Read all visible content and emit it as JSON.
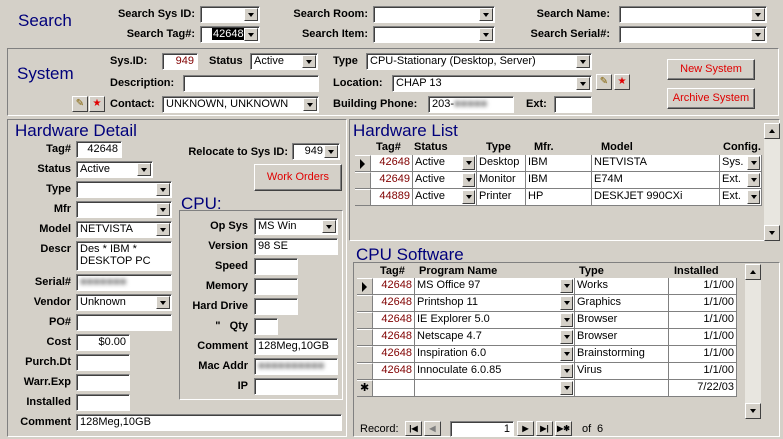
{
  "search": {
    "title": "Search",
    "sys_id_label": "Search Sys ID:",
    "sys_id_value": "",
    "tag_label": "Search Tag#:",
    "tag_value": "42648",
    "room_label": "Search Room:",
    "room_value": "",
    "item_label": "Search Item:",
    "item_value": "",
    "name_label": "Search Name:",
    "name_value": "",
    "serial_label": "Search Serial#:",
    "serial_value": ""
  },
  "system": {
    "title": "System",
    "sys_id_label": "Sys.ID:",
    "sys_id_value": "949",
    "status_label": "Status",
    "status_value": "Active",
    "type_label": "Type",
    "type_value": "CPU-Stationary (Desktop, Server)",
    "description_label": "Description:",
    "description_value": "",
    "location_label": "Location:",
    "location_value": "CHAP 13",
    "contact_label": "Contact:",
    "contact_value": "UNKNOWN, UNKNOWN",
    "building_phone_label": "Building Phone:",
    "building_phone_value": "203-",
    "ext_label": "Ext:",
    "ext_value": "",
    "new_system_button": "New System",
    "archive_system_button": "Archive System"
  },
  "hardware_detail": {
    "title": "Hardware Detail",
    "tag_label": "Tag#",
    "tag_value": "42648",
    "relocate_label": "Relocate to Sys ID:",
    "relocate_value": "949",
    "status_label": "Status",
    "status_value": "Active",
    "work_orders_button": "Work Orders",
    "type_label": "Type",
    "type_value": "",
    "mfr_label": "Mfr",
    "mfr_value": "",
    "model_label": "Model",
    "model_value": "NETVISTA",
    "descr_label": "Descr",
    "descr_value": "Des * IBM * DESKTOP PC",
    "serial_label": "Serial#",
    "vendor_label": "Vendor",
    "vendor_value": "Unknown",
    "po_label": "PO#",
    "po_value": "",
    "cost_label": "Cost",
    "cost_value": "$0.00",
    "purch_label": "Purch.Dt",
    "purch_value": "",
    "warr_label": "Warr.Exp",
    "warr_value": "",
    "installed_label": "Installed",
    "installed_value": "",
    "comment_label": "Comment",
    "comment_value": "128Meg,10GB"
  },
  "cpu": {
    "title": "CPU:",
    "opsys_label": "Op Sys",
    "opsys_value": "MS Win",
    "version_label": "Version",
    "version_value": "98 SE",
    "speed_label": "Speed",
    "speed_value": "",
    "memory_label": "Memory",
    "memory_value": "",
    "hard_drive_label": "Hard Drive",
    "hard_drive_value": "",
    "qty_label": "\"   Qty",
    "qty_value": "",
    "comment_label": "Comment",
    "comment_value": "128Meg,10GB",
    "mac_label": "Mac Addr",
    "ip_label": "IP",
    "ip_value": ""
  },
  "hardware_list": {
    "title": "Hardware List",
    "headers": [
      "Tag#",
      "Status",
      "Type",
      "Mfr.",
      "Model",
      "Config."
    ],
    "rows": [
      {
        "tag": "42648",
        "status": "Active",
        "type": "Desktop",
        "mfr": "IBM",
        "model": "NETVISTA",
        "config": "Sys."
      },
      {
        "tag": "42649",
        "status": "Active",
        "type": "Monitor",
        "mfr": "IBM",
        "model": "E74M",
        "config": "Ext."
      },
      {
        "tag": "44889",
        "status": "Active",
        "type": "Printer",
        "mfr": "HP",
        "model": "DESKJET 990CXi",
        "config": "Ext."
      }
    ]
  },
  "cpu_software": {
    "title": "CPU Software",
    "headers": [
      "Tag#",
      "Program Name",
      "Type",
      "Installed"
    ],
    "rows": [
      {
        "tag": "42648",
        "program": "MS Office 97",
        "type": "Works",
        "installed": "1/1/00"
      },
      {
        "tag": "42648",
        "program": "Printshop 11",
        "type": "Graphics",
        "installed": "1/1/00"
      },
      {
        "tag": "42648",
        "program": "IE Explorer 5.0",
        "type": "Browser",
        "installed": "1/1/00"
      },
      {
        "tag": "42648",
        "program": "Netscape 4.7",
        "type": "Browser",
        "installed": "1/1/00"
      },
      {
        "tag": "42648",
        "program": "Inspiration 6.0",
        "type": "Brainstorming",
        "installed": "1/1/00"
      },
      {
        "tag": "42648",
        "program": "Innoculate 6.0.85",
        "type": "Virus",
        "installed": "1/1/00"
      }
    ],
    "new_row_installed": "7/22/03",
    "record_label": "Record:",
    "record_value": "1",
    "of_label": "of",
    "record_total": "6"
  },
  "icons": {
    "edit": "pencil-icon",
    "new": "star-icon"
  }
}
